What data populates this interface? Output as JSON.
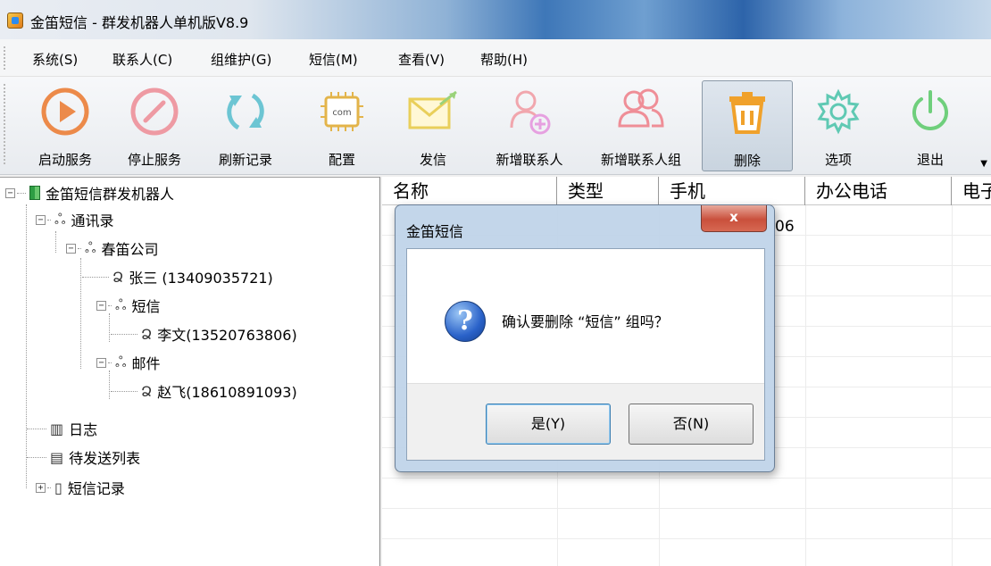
{
  "window": {
    "title": "金笛短信 - 群发机器人单机版V8.9",
    "icon": "app-icon"
  },
  "menu": {
    "items": [
      {
        "label": "系统(S)"
      },
      {
        "label": "联系人(C)"
      },
      {
        "label": "组维护(G)"
      },
      {
        "label": "短信(M)"
      },
      {
        "label": "查看(V)"
      },
      {
        "label": "帮助(H)"
      }
    ]
  },
  "toolbar": {
    "buttons": [
      {
        "label": "启动服务",
        "icon": "play-circle-icon"
      },
      {
        "label": "停止服务",
        "icon": "stop-circle-icon"
      },
      {
        "label": "刷新记录",
        "icon": "refresh-icon"
      },
      {
        "label": "配置",
        "icon": "com-chip-icon"
      },
      {
        "label": "发信",
        "icon": "envelope-send-icon"
      },
      {
        "label": "新增联系人",
        "icon": "add-contact-icon"
      },
      {
        "label": "新增联系人组",
        "icon": "add-group-icon"
      },
      {
        "label": "删除",
        "icon": "trash-icon",
        "active": true
      },
      {
        "label": "选项",
        "icon": "gear-icon"
      },
      {
        "label": "退出",
        "icon": "power-icon"
      }
    ]
  },
  "tree": {
    "root": "金笛短信群发机器人",
    "contacts": "通讯录",
    "company": "春笛公司",
    "person1": "张三 (13409035721)",
    "group_sms": "短信",
    "person2": "李文(13520763806)",
    "group_mail": "邮件",
    "person3": "赵飞(18610891093)",
    "log": "日志",
    "pending": "待发送列表",
    "records": "短信记录"
  },
  "grid": {
    "columns": [
      "名称",
      "类型",
      "手机",
      "办公电话",
      "电子"
    ],
    "visible_fragment": "06"
  },
  "dialog": {
    "title": "金笛短信",
    "close": "x",
    "message": "确认要删除 “短信” 组吗？",
    "yes": "是(Y)",
    "no": "否(N)"
  },
  "colors": {
    "accent": "#2a62c9",
    "close_button": "#c9503c",
    "icon_orange": "#e8823a",
    "icon_pink": "#e8838f",
    "icon_teal": "#3bb5a4",
    "icon_green": "#4fbf67"
  }
}
